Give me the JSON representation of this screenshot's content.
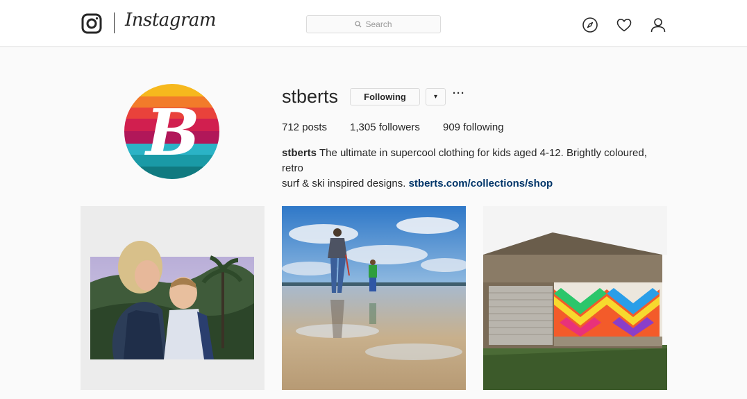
{
  "nav": {
    "brand": "Instagram",
    "search_placeholder": "Search"
  },
  "profile": {
    "username": "stberts",
    "following_button": "Following",
    "dropdown_glyph": "▾",
    "more_glyph": "···",
    "stats": {
      "posts_count": "712",
      "posts_label": "posts",
      "followers_count": "1,305",
      "followers_label": "followers",
      "following_count": "909",
      "following_label": "following"
    },
    "bio": {
      "name": "stberts",
      "line1": "The ultimate in supercool clothing for kids aged 4-12. Brightly coloured, retro",
      "line2": "surf & ski inspired designs.",
      "link": "stberts.com/collections/shop"
    },
    "avatar_monogram": "B"
  },
  "colors": {
    "text": "#262626",
    "border": "#dbdbdb",
    "link": "#003569",
    "page_bg": "#fafafa"
  },
  "icons": [
    "instagram-glyph-icon",
    "search-icon",
    "compass-icon",
    "heart-icon",
    "user-icon"
  ],
  "posts": [
    {
      "subject": "woman-and-child-photo"
    },
    {
      "subject": "beach-walk-photo"
    },
    {
      "subject": "painted-barn-photo"
    }
  ]
}
